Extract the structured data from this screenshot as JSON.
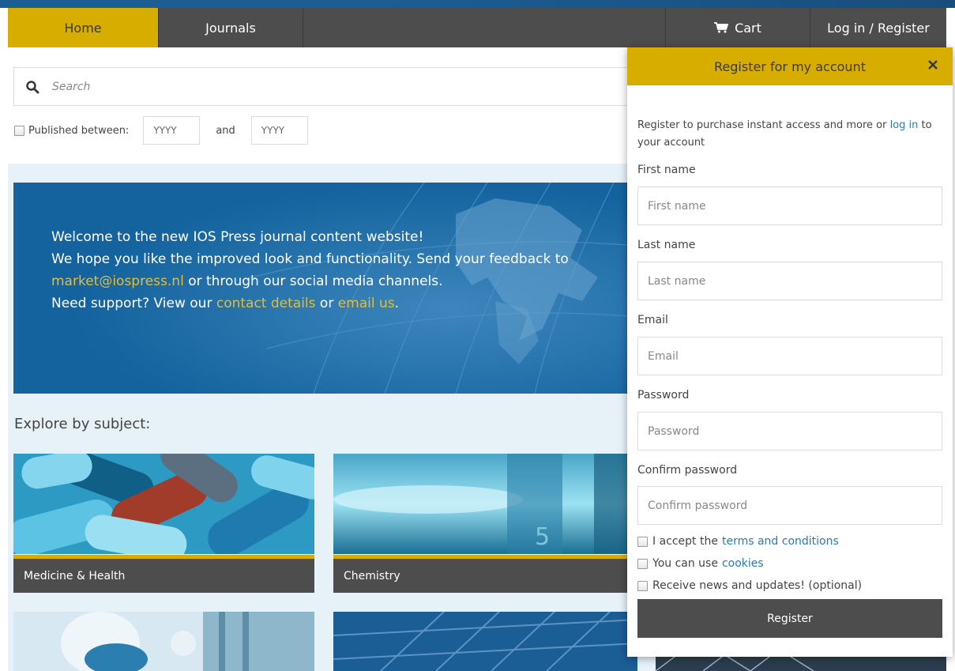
{
  "nav": {
    "home": "Home",
    "journals": "Journals",
    "cart": "Cart",
    "login": "Log in / Register"
  },
  "search": {
    "placeholder": "Search"
  },
  "filter": {
    "published_label": "Published between:",
    "year_from": "YYYY",
    "and_label": "and",
    "year_to": "YYYY"
  },
  "banner": {
    "line1": "Welcome to the new IOS Press journal content website!",
    "line2": "We hope you like the improved look and functionality. Send your feedback to",
    "email_link": "market@iospress.nl",
    "line3_rest": " or through our social media channels.",
    "line4_prefix": "Need support? View our ",
    "contact_link": "contact details",
    "or": " or ",
    "email_us_link": "email us",
    "period": "."
  },
  "explore_title": "Explore by subject:",
  "subjects": [
    {
      "label": "Medicine & Health"
    },
    {
      "label": "Chemistry"
    }
  ],
  "modal": {
    "title": "Register for my account",
    "intro_prefix": "Register to purchase instant access and more or ",
    "intro_link": "log in",
    "intro_suffix": " to your account",
    "first_name_label": "First name",
    "first_name_placeholder": "First name",
    "last_name_label": "Last name",
    "last_name_placeholder": "Last name",
    "email_label": "Email",
    "email_placeholder": "Email",
    "password_label": "Password",
    "password_placeholder": "Password",
    "confirm_label": "Confirm password",
    "confirm_placeholder": "Confirm password",
    "terms_prefix": "I accept the",
    "terms_link": "terms and conditions",
    "cookies_prefix": "You can use",
    "cookies_link": "cookies",
    "news_label": "Receive news and updates! (optional)",
    "register_button": "Register"
  },
  "colors": {
    "accent": "#d7ad00",
    "nav_bg": "#4d4d4d",
    "banner_bg": "#14639e",
    "link": "#2a7ab5",
    "banner_link": "#e1be3c"
  }
}
